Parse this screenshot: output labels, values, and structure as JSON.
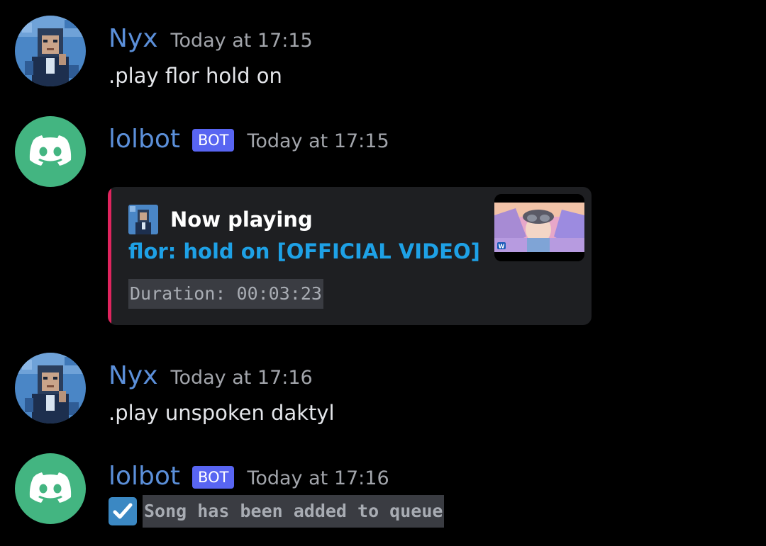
{
  "messages": [
    {
      "username": "Nyx",
      "timestamp": "Today at 17:15",
      "content": ".play flor hold on"
    },
    {
      "username": "lolbot",
      "bot_tag": "BOT",
      "timestamp": "Today at 17:15",
      "embed": {
        "author": "Now playing",
        "title": "flor: hold on [OFFICIAL VIDEO]",
        "description": "Duration: 00:03:23",
        "accent_color": "#e0245e"
      }
    },
    {
      "username": "Nyx",
      "timestamp": "Today at 17:16",
      "content": ".play unspoken daktyl"
    },
    {
      "username": "lolbot",
      "bot_tag": "BOT",
      "timestamp": "Today at 17:16",
      "content_code": "Song has been added to queue",
      "content_icon": "check-box-icon"
    }
  ],
  "colors": {
    "background": "#000000",
    "username": "#5b8fd9",
    "bot_tag": "#5865f2",
    "bot_avatar": "#43b581",
    "link": "#1ea1e6",
    "checkbox": "#3b88c3"
  }
}
